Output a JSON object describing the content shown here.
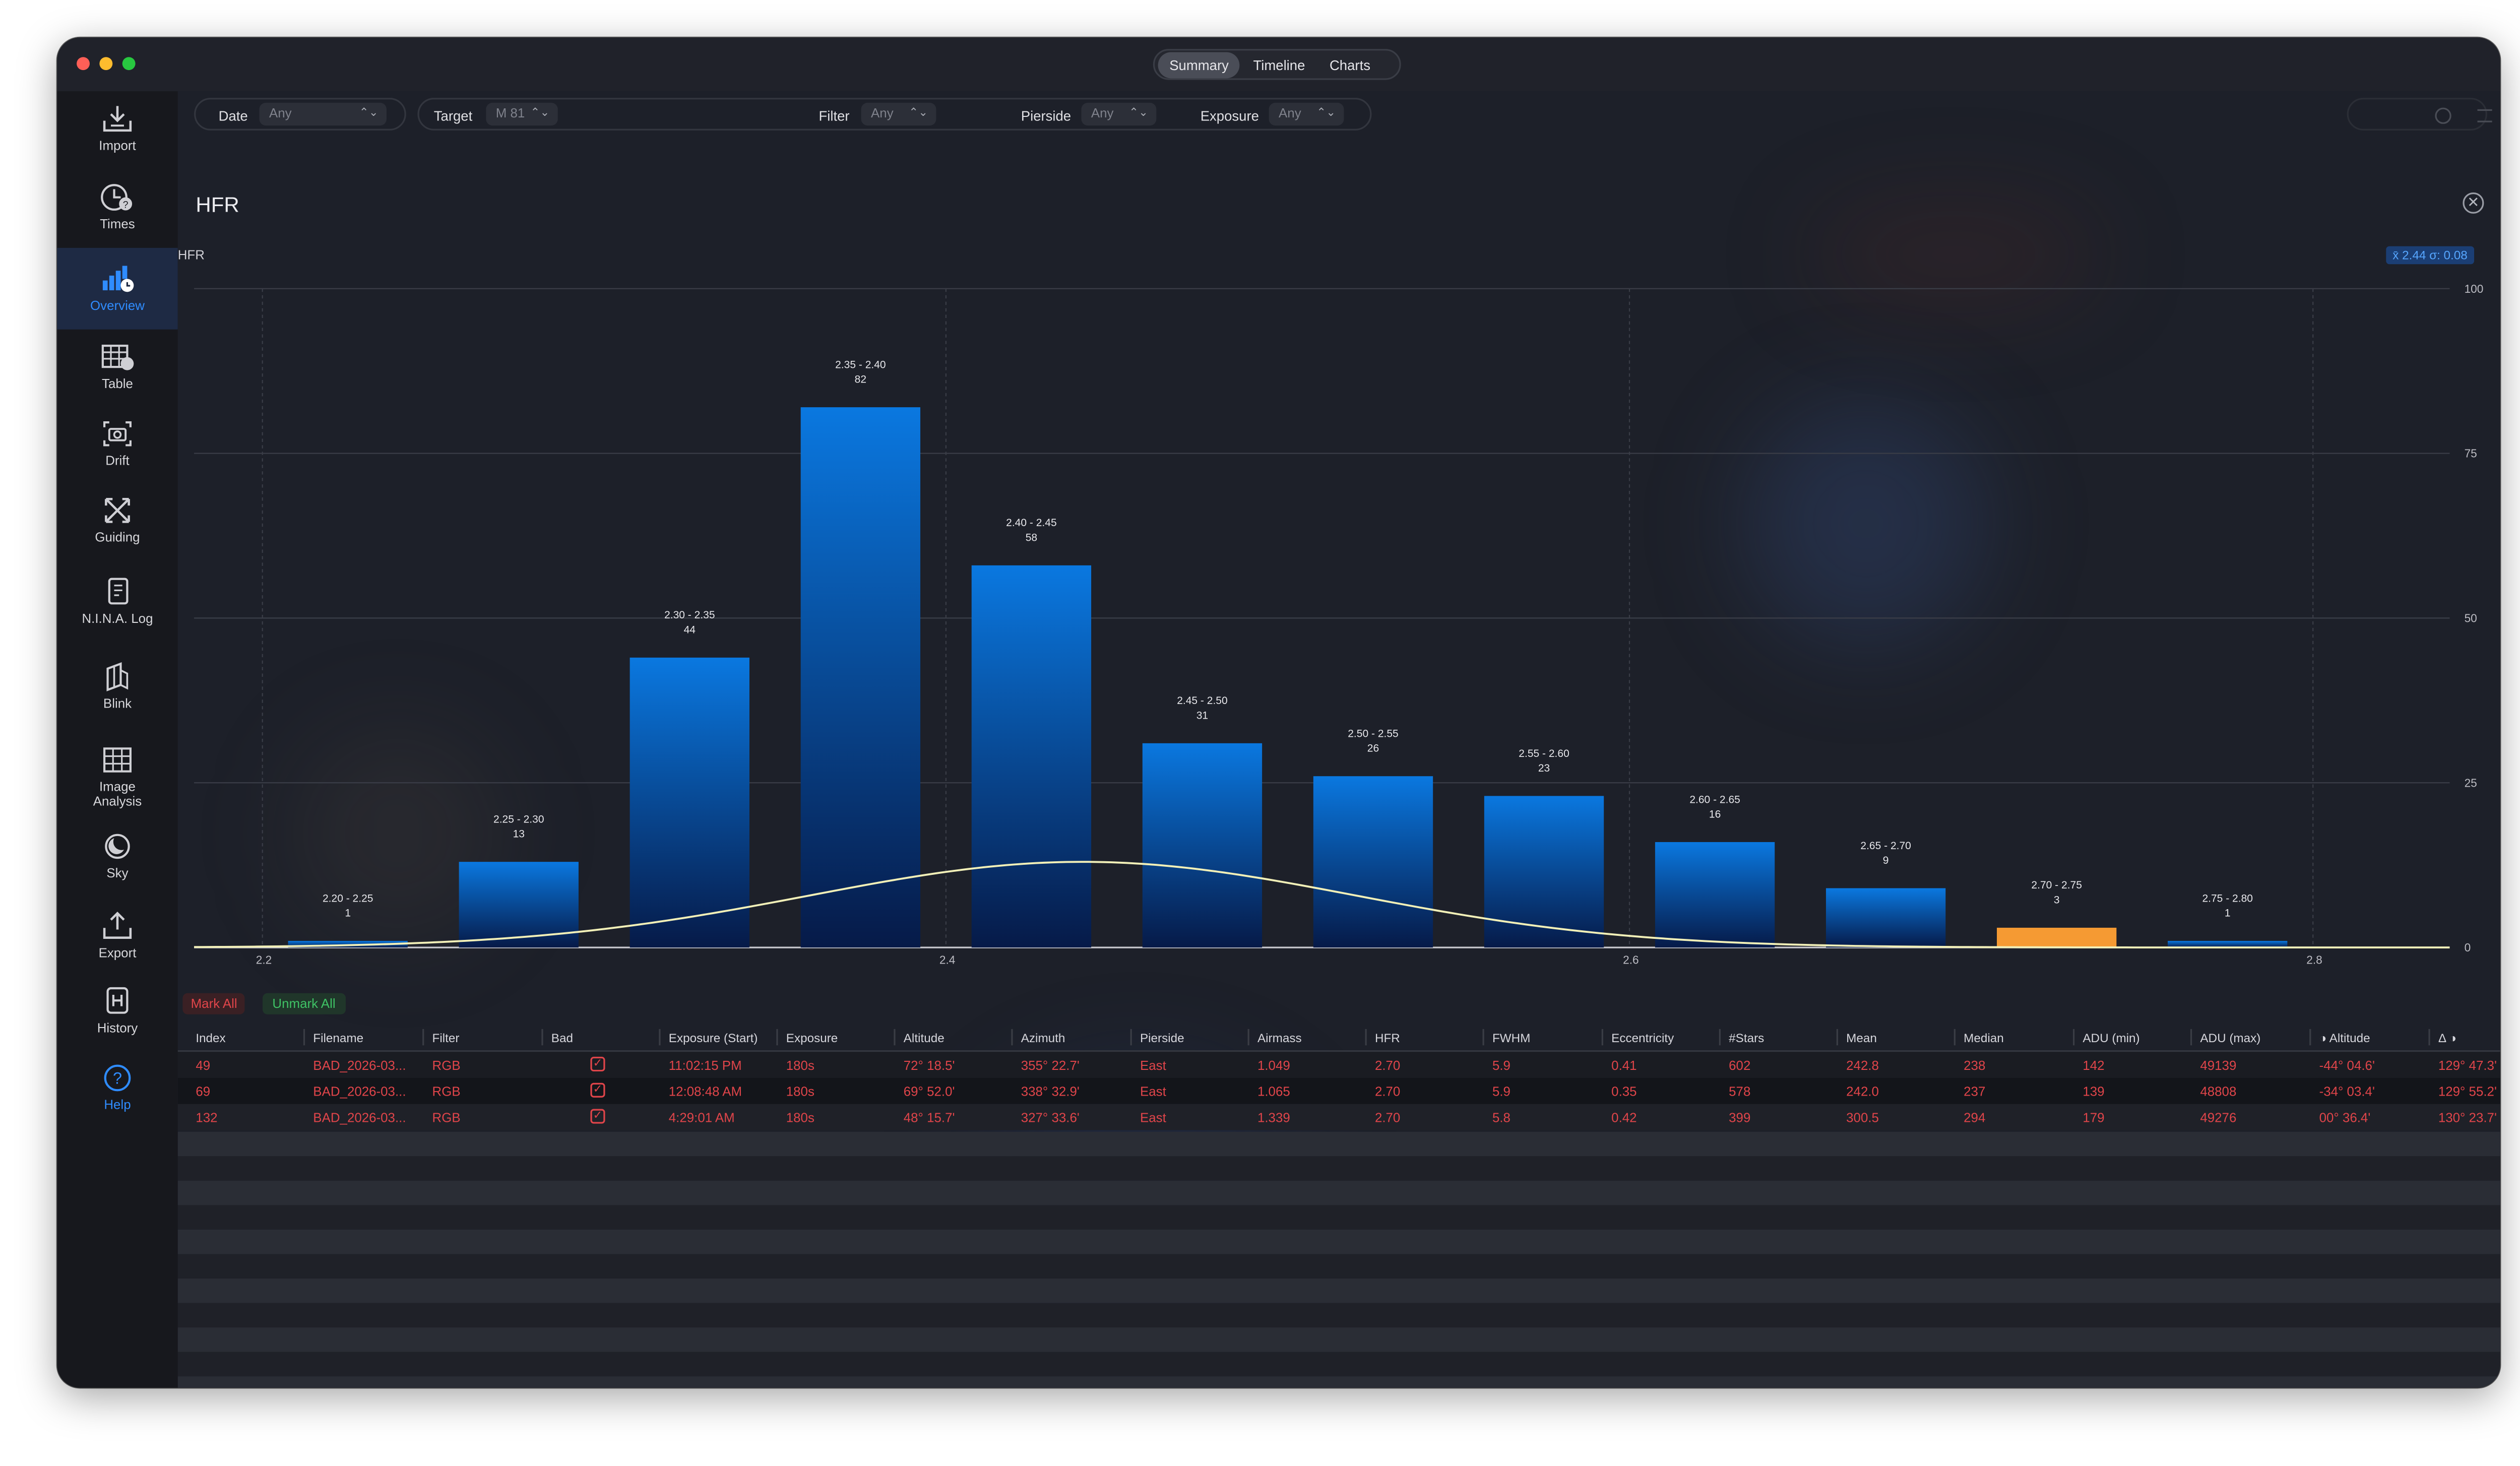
{
  "window": {
    "tabs": [
      {
        "label": "Summary",
        "active": true
      },
      {
        "label": "Timeline",
        "active": false
      },
      {
        "label": "Charts",
        "active": false
      }
    ]
  },
  "sidebar": {
    "items": [
      {
        "label": "Import",
        "icon": "import-icon",
        "active": false
      },
      {
        "label": "Times",
        "icon": "clock-icon",
        "active": false
      },
      {
        "label": "Overview",
        "icon": "bar-chart-icon",
        "active": true
      },
      {
        "label": "Table",
        "icon": "table-icon",
        "active": false
      },
      {
        "label": "Drift",
        "icon": "camera-icon",
        "active": false
      },
      {
        "label": "Guiding",
        "icon": "arrows-icon",
        "active": false
      },
      {
        "label": "N.I.N.A. Log",
        "icon": "document-icon",
        "active": false
      },
      {
        "label": "Blink",
        "icon": "layers-icon",
        "active": false
      },
      {
        "label": "Image Analysis",
        "icon": "grid-icon",
        "active": false
      },
      {
        "label": "Sky",
        "icon": "moon-icon",
        "active": false
      },
      {
        "label": "Export",
        "icon": "export-icon",
        "active": false
      },
      {
        "label": "History",
        "icon": "history-icon",
        "active": false
      },
      {
        "label": "Help",
        "icon": "help-icon",
        "active": false
      }
    ]
  },
  "filters": {
    "date": {
      "label": "Date",
      "value": "Any"
    },
    "target": {
      "label": "Target",
      "value": "M 81"
    },
    "filter": {
      "label": "Filter",
      "value": "Any"
    },
    "pierside": {
      "label": "Pierside",
      "value": "Any"
    },
    "exposure": {
      "label": "Exposure",
      "value": "Any"
    }
  },
  "panel": {
    "title": "HFR",
    "chart_label": "HFR",
    "stats_badge": "x̄ 2.44  σ: 0.08"
  },
  "colors": {
    "bar_top": "#0a78e0",
    "bar_bottom": "#061a48",
    "highlight_bar": "#f59a33",
    "curve": "#f2f0b8",
    "bad_text": "#e0454a"
  },
  "chart_data": {
    "type": "bar",
    "categories": [
      "2.20 - 2.25",
      "2.25 - 2.30",
      "2.30 - 2.35",
      "2.35 - 2.40",
      "2.40 - 2.45",
      "2.45 - 2.50",
      "2.50 - 2.55",
      "2.55 - 2.60",
      "2.60 - 2.65",
      "2.65 - 2.70",
      "2.70 - 2.75",
      "2.75 - 2.80"
    ],
    "bin_start": [
      2.2,
      2.25,
      2.3,
      2.35,
      2.4,
      2.45,
      2.5,
      2.55,
      2.6,
      2.65,
      2.7,
      2.75
    ],
    "bin_width": 0.05,
    "values": [
      1,
      13,
      44,
      82,
      58,
      31,
      26,
      23,
      16,
      9,
      3,
      1
    ],
    "highlight_index": 10,
    "xlim": [
      2.18,
      2.84
    ],
    "ylim": [
      0,
      100
    ],
    "x_ticks": [
      2.2,
      2.4,
      2.6,
      2.8
    ],
    "x_tick_labels": [
      "2.2",
      "2.4",
      "2.6",
      "2.8"
    ],
    "y_ticks": [
      0,
      25,
      50,
      75,
      100
    ],
    "y_tick_labels": [
      "0",
      "25",
      "50",
      "75",
      "100"
    ],
    "curve": {
      "mean": 2.44,
      "sigma": 0.08,
      "peak": 13
    },
    "grid": true
  },
  "actions": {
    "mark_all": "Mark All",
    "unmark_all": "Unmark All"
  },
  "table": {
    "columns": [
      "Index",
      "Filename",
      "Filter",
      "Bad",
      "Exposure (Start)",
      "Exposure",
      "Altitude",
      "Azimuth",
      "Pierside",
      "Airmass",
      "HFR",
      "FWHM",
      "Eccentricity",
      "#Stars",
      "Mean",
      "Median",
      "ADU (min)",
      "ADU (max)",
      "Altitude",
      "Δ"
    ],
    "rows": [
      [
        "49",
        "BAD_2026-03...",
        "RGB",
        "✓",
        "11:02:15 PM",
        "180s",
        "72° 18.5'",
        "355° 22.7'",
        "East",
        "1.049",
        "2.70",
        "5.9",
        "0.41",
        "602",
        "242.8",
        "238",
        "142",
        "49139",
        "-44° 04.6'",
        "129° 47.3'"
      ],
      [
        "69",
        "BAD_2026-03...",
        "RGB",
        "✓",
        "12:08:48 AM",
        "180s",
        "69° 52.0'",
        "338° 32.9'",
        "East",
        "1.065",
        "2.70",
        "5.9",
        "0.35",
        "578",
        "242.0",
        "237",
        "139",
        "48808",
        "-34° 03.4'",
        "129° 55.2'"
      ],
      [
        "132",
        "BAD_2026-03...",
        "RGB",
        "✓",
        "4:29:01 AM",
        "180s",
        "48° 15.7'",
        "327° 33.6'",
        "East",
        "1.339",
        "2.70",
        "5.8",
        "0.42",
        "399",
        "300.5",
        "294",
        "179",
        "49276",
        "00° 36.4'",
        "130° 23.7'"
      ]
    ]
  }
}
